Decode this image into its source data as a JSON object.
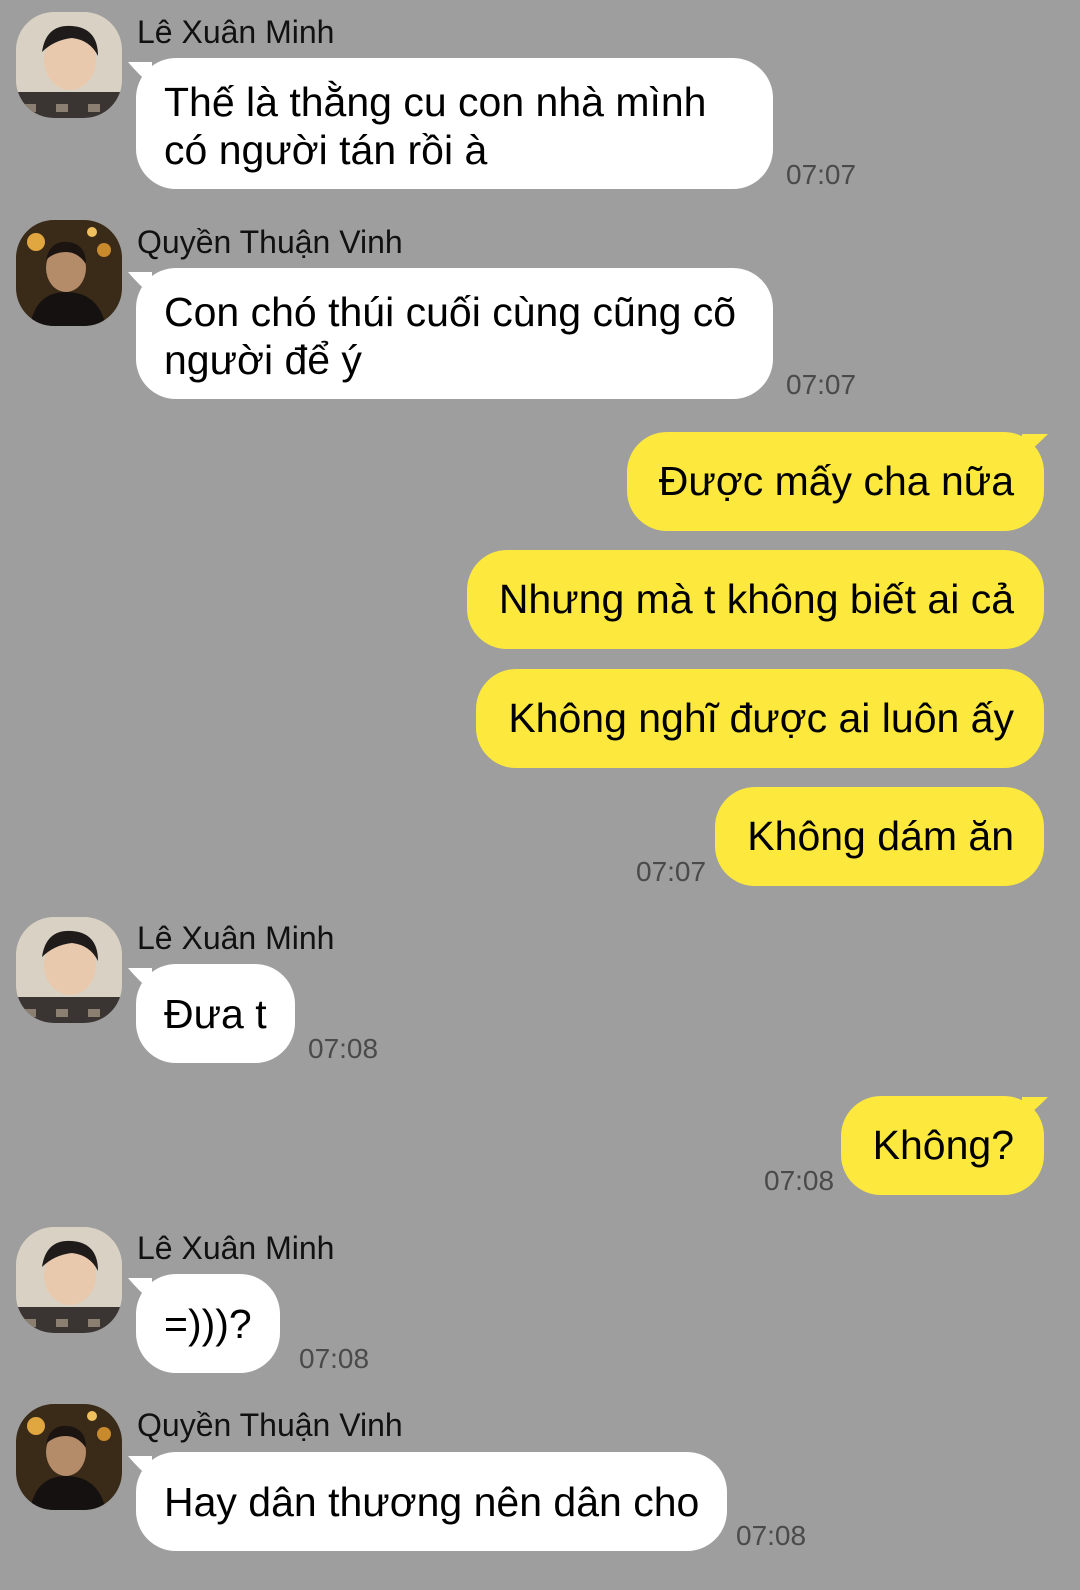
{
  "colors": {
    "background": "#9e9e9e",
    "incoming_bubble": "#ffffff",
    "outgoing_bubble": "#fde93e",
    "timestamp": "#4a4a4a"
  },
  "messages": [
    {
      "sender": "Lê Xuân Minh",
      "avatar": "avatar-le-xuan-minh",
      "text": "Thế là thằng cu con nhà mình\ncó người tán rồi à",
      "time": "07:07"
    },
    {
      "sender": "Quyền Thuận Vinh",
      "avatar": "avatar-quyen-thuan-vinh",
      "text": "Con chó thúi cuối cùng cũng cõ\nngười để ý",
      "time": "07:07"
    },
    {
      "outgoing": true,
      "text": "Được mấy cha nữa"
    },
    {
      "outgoing": true,
      "text": "Nhưng mà t không biết ai cả"
    },
    {
      "outgoing": true,
      "text": "Không nghĩ được ai luôn ấy"
    },
    {
      "outgoing": true,
      "text": "Không dám ăn",
      "time": "07:07"
    },
    {
      "sender": "Lê Xuân Minh",
      "avatar": "avatar-le-xuan-minh",
      "text": "Đưa t",
      "time": "07:08"
    },
    {
      "outgoing": true,
      "text": "Không?",
      "time": "07:08"
    },
    {
      "sender": "Lê Xuân Minh",
      "avatar": "avatar-le-xuan-minh",
      "text": "=)))?",
      "time": "07:08"
    },
    {
      "sender": "Quyền Thuận Vinh",
      "avatar": "avatar-quyen-thuan-vinh",
      "text": "Hay dân thương nên dân cho",
      "time": "07:08"
    }
  ]
}
